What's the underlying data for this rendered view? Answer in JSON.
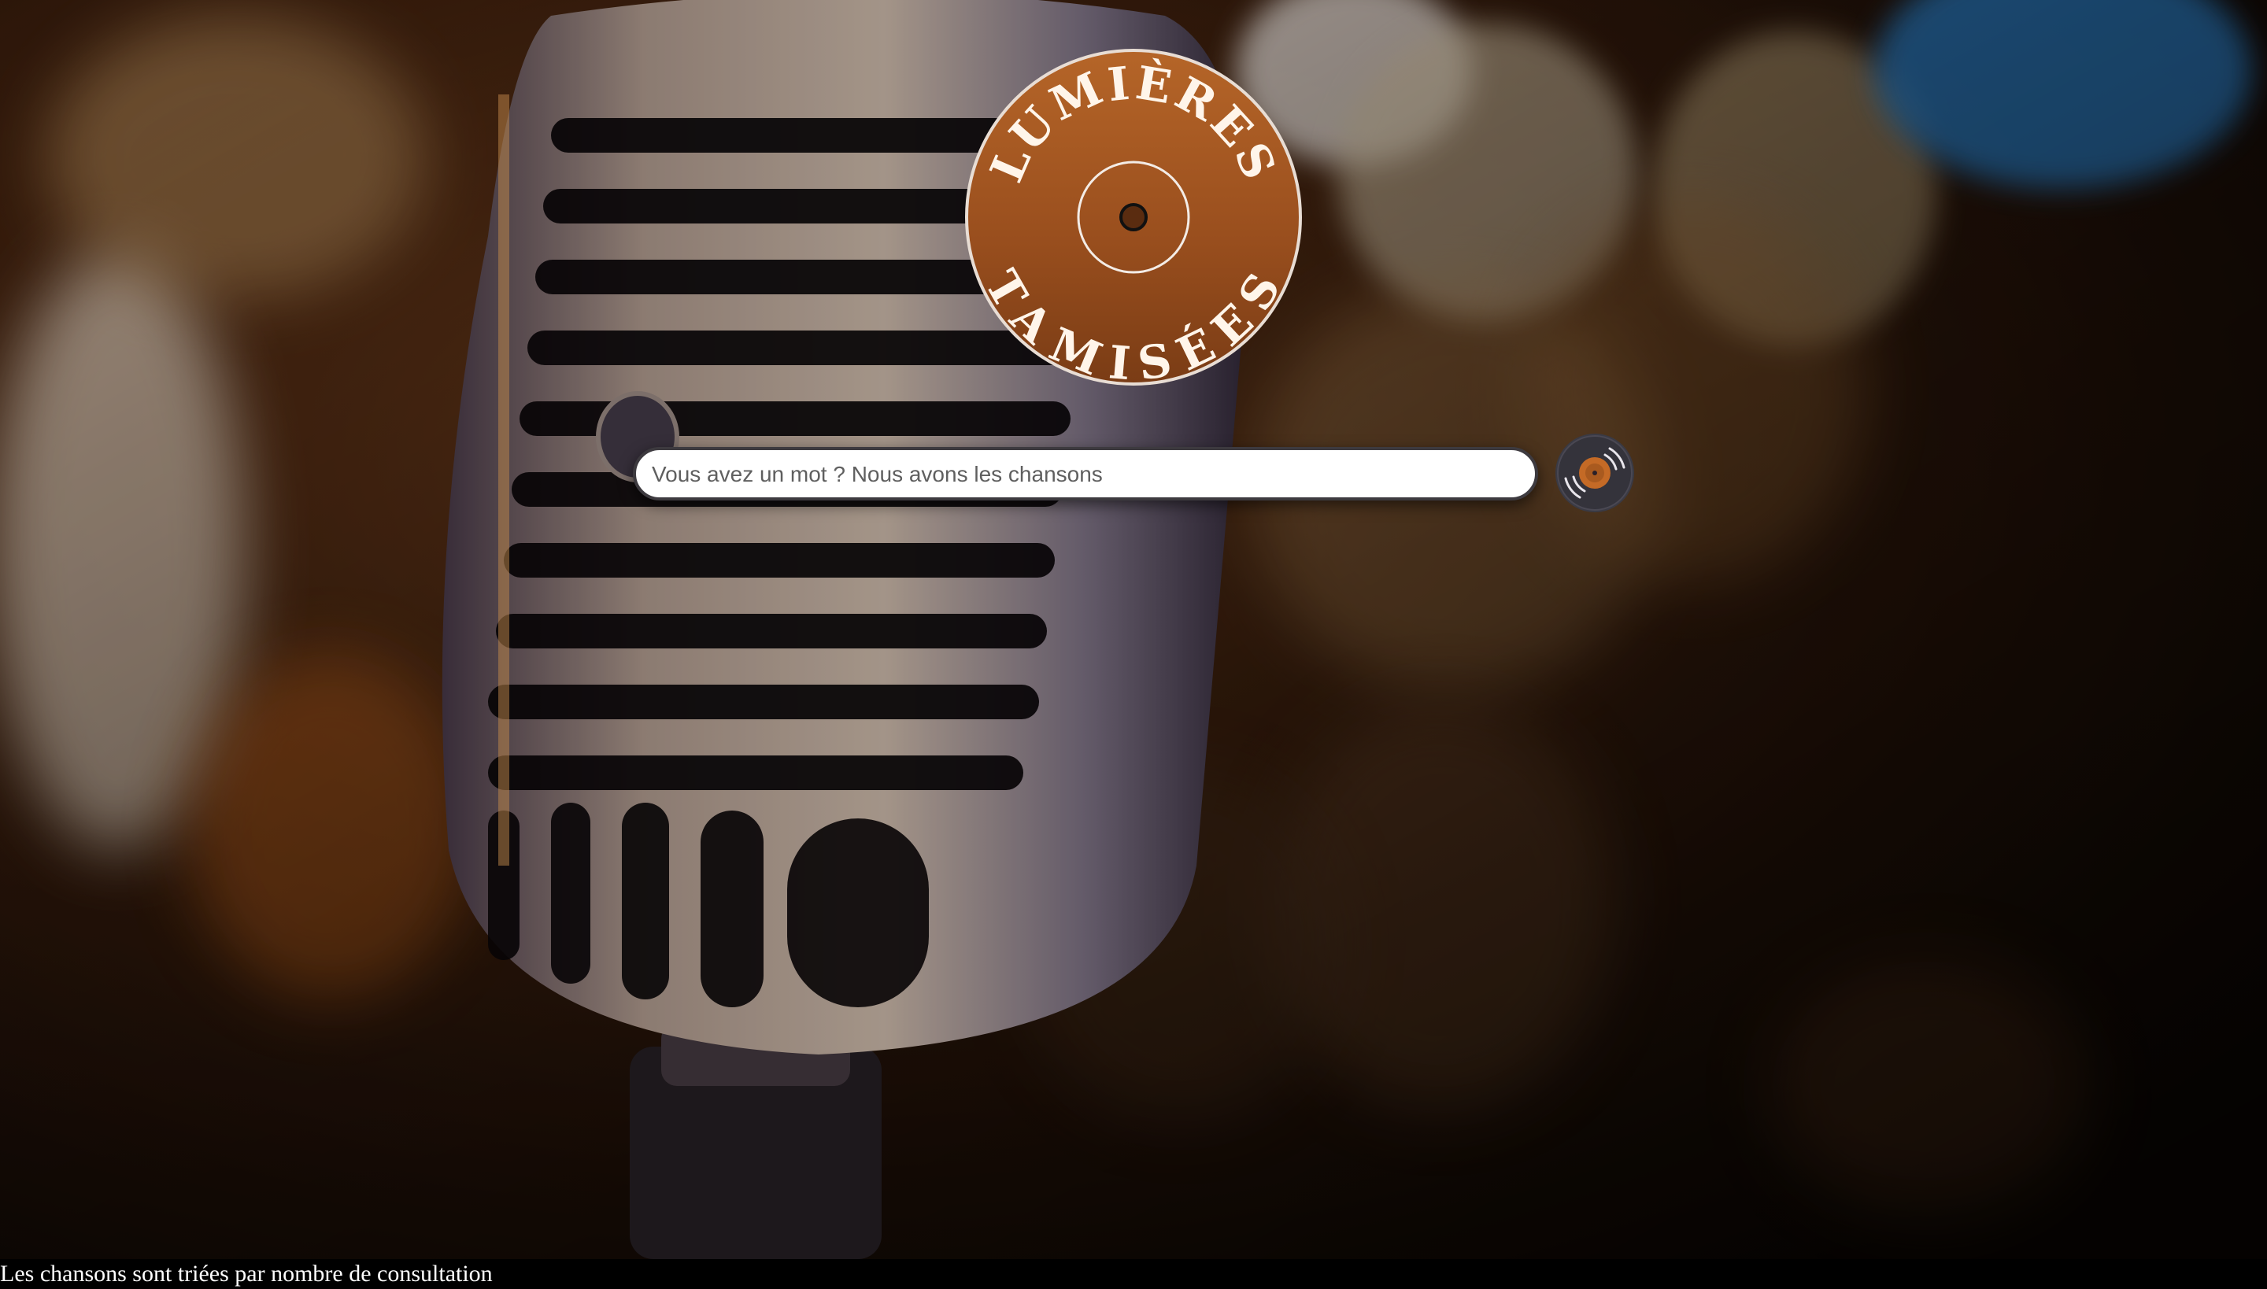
{
  "logo": {
    "line_top": "LUMIÈRES",
    "line_bottom": "TAMISÉES",
    "color": "#a85a24"
  },
  "search": {
    "placeholder": "Vous avez un mot ? Nous avons les chansons",
    "value": ""
  },
  "search_button": {
    "icon": "vinyl-record-icon",
    "accent": "#c46a26"
  },
  "footer": {
    "note": "Les chansons sont triées par nombre de consultation"
  },
  "background": {
    "image": "vintage-microphone-bokeh-photo"
  }
}
